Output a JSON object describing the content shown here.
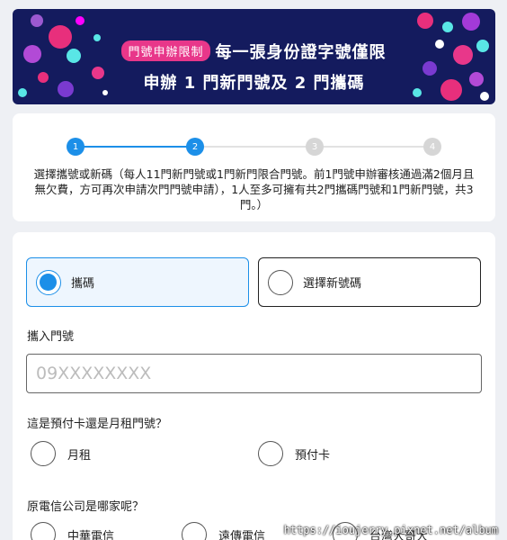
{
  "banner": {
    "badge": "門號申辦限制",
    "line1": "每一張身份證字號僅限",
    "line2": "申辦 1 門新門號及 2 門攜碼"
  },
  "stepper": {
    "steps": [
      {
        "number": "1",
        "state": "done"
      },
      {
        "number": "2",
        "state": "active"
      },
      {
        "number": "3",
        "state": "inactive"
      },
      {
        "number": "4",
        "state": "inactive"
      }
    ],
    "description": "選擇攜號或新碼（每人11門新門號或1門新門限合門號。前1門號申辦審核通過滿2個月且無欠費，方可再次申請次門門號申請），1人至多可擁有共2門攜碼門號和1門新門號，共3門。）"
  },
  "form": {
    "type_options": [
      {
        "label": "攜碼",
        "selected": true
      },
      {
        "label": "選擇新號碼",
        "selected": false
      }
    ],
    "port_number_label": "攜入門號",
    "port_number_placeholder": "09XXXXXXXX",
    "plan_question": "這是預付卡還是月租門號？",
    "plan_options": [
      {
        "label": "月租"
      },
      {
        "label": "預付卡"
      }
    ],
    "carrier_question": "原電信公司是哪家呢？",
    "carrier_options": [
      {
        "label": "中華電信"
      },
      {
        "label": "遠傳電信"
      },
      {
        "label": "台灣大哥大"
      }
    ]
  },
  "colors": {
    "accent": "#1c8fe8",
    "banner_bg": "#141b5e",
    "badge": "#e8378a",
    "selected_bg": "#eef6fe"
  },
  "watermark": "https://ioujerry.pixnet.net/album"
}
